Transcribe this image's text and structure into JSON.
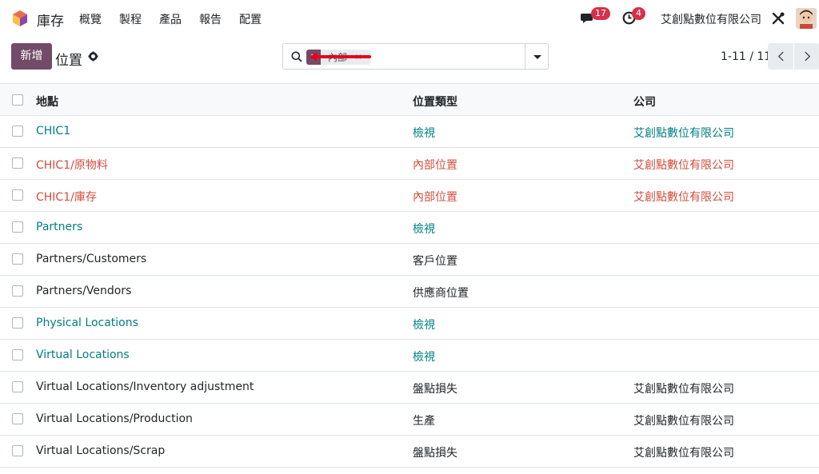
{
  "app": {
    "name": "庫存"
  },
  "menu": [
    "概覽",
    "製程",
    "產品",
    "報告",
    "配置"
  ],
  "nav": {
    "messages_count": "17",
    "activities_count": "4",
    "company": "艾創點數位有限公司"
  },
  "control": {
    "new_label": "新增",
    "title": "位置"
  },
  "search": {
    "facet_label": "內部",
    "facet_close": "×"
  },
  "pager": {
    "value": "1-11 / 11"
  },
  "table": {
    "headers": [
      "地點",
      "位置類型",
      "公司"
    ],
    "rows": [
      {
        "location": "CHIC1",
        "type": "檢視",
        "company": "艾創點數位有限公司",
        "style": "view"
      },
      {
        "location": "CHIC1/原物料",
        "type": "內部位置",
        "company": "艾創點數位有限公司",
        "style": "internal"
      },
      {
        "location": "CHIC1/庫存",
        "type": "內部位置",
        "company": "艾創點數位有限公司",
        "style": "internal"
      },
      {
        "location": "Partners",
        "type": "檢視",
        "company": "",
        "style": "view"
      },
      {
        "location": "Partners/Customers",
        "type": "客戶位置",
        "company": "",
        "style": "normal"
      },
      {
        "location": "Partners/Vendors",
        "type": "供應商位置",
        "company": "",
        "style": "normal"
      },
      {
        "location": "Physical Locations",
        "type": "檢視",
        "company": "",
        "style": "view"
      },
      {
        "location": "Virtual Locations",
        "type": "檢視",
        "company": "",
        "style": "view"
      },
      {
        "location": "Virtual Locations/Inventory adjustment",
        "type": "盤點損失",
        "company": "艾創點數位有限公司",
        "style": "normal"
      },
      {
        "location": "Virtual Locations/Production",
        "type": "生產",
        "company": "艾創點數位有限公司",
        "style": "normal"
      },
      {
        "location": "Virtual Locations/Scrap",
        "type": "盤點損失",
        "company": "艾創點數位有限公司",
        "style": "normal"
      }
    ]
  },
  "colors": {
    "brand": "#714b67",
    "link": "#017e84",
    "internal": "#d44c3b",
    "badge": "#d9304a",
    "annotation": "#e6001e"
  },
  "icons": [
    "app-logo",
    "chat-icon",
    "clock-icon",
    "tools-icon",
    "gear-icon",
    "search-icon",
    "filter-icon",
    "chevron-left-icon",
    "chevron-right-icon",
    "caret-down-icon"
  ]
}
